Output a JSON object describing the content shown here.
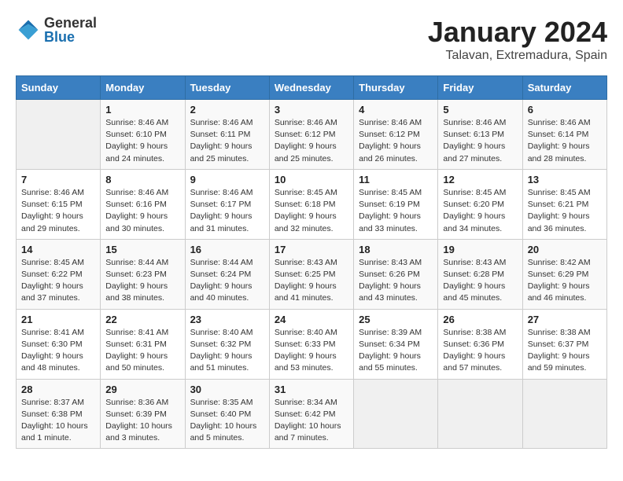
{
  "header": {
    "logo_general": "General",
    "logo_blue": "Blue",
    "month_title": "January 2024",
    "location": "Talavan, Extremadura, Spain"
  },
  "days_of_week": [
    "Sunday",
    "Monday",
    "Tuesday",
    "Wednesday",
    "Thursday",
    "Friday",
    "Saturday"
  ],
  "weeks": [
    [
      {
        "day": "",
        "info": ""
      },
      {
        "day": "1",
        "info": "Sunrise: 8:46 AM\nSunset: 6:10 PM\nDaylight: 9 hours\nand 24 minutes."
      },
      {
        "day": "2",
        "info": "Sunrise: 8:46 AM\nSunset: 6:11 PM\nDaylight: 9 hours\nand 25 minutes."
      },
      {
        "day": "3",
        "info": "Sunrise: 8:46 AM\nSunset: 6:12 PM\nDaylight: 9 hours\nand 25 minutes."
      },
      {
        "day": "4",
        "info": "Sunrise: 8:46 AM\nSunset: 6:12 PM\nDaylight: 9 hours\nand 26 minutes."
      },
      {
        "day": "5",
        "info": "Sunrise: 8:46 AM\nSunset: 6:13 PM\nDaylight: 9 hours\nand 27 minutes."
      },
      {
        "day": "6",
        "info": "Sunrise: 8:46 AM\nSunset: 6:14 PM\nDaylight: 9 hours\nand 28 minutes."
      }
    ],
    [
      {
        "day": "7",
        "info": "Sunrise: 8:46 AM\nSunset: 6:15 PM\nDaylight: 9 hours\nand 29 minutes."
      },
      {
        "day": "8",
        "info": "Sunrise: 8:46 AM\nSunset: 6:16 PM\nDaylight: 9 hours\nand 30 minutes."
      },
      {
        "day": "9",
        "info": "Sunrise: 8:46 AM\nSunset: 6:17 PM\nDaylight: 9 hours\nand 31 minutes."
      },
      {
        "day": "10",
        "info": "Sunrise: 8:45 AM\nSunset: 6:18 PM\nDaylight: 9 hours\nand 32 minutes."
      },
      {
        "day": "11",
        "info": "Sunrise: 8:45 AM\nSunset: 6:19 PM\nDaylight: 9 hours\nand 33 minutes."
      },
      {
        "day": "12",
        "info": "Sunrise: 8:45 AM\nSunset: 6:20 PM\nDaylight: 9 hours\nand 34 minutes."
      },
      {
        "day": "13",
        "info": "Sunrise: 8:45 AM\nSunset: 6:21 PM\nDaylight: 9 hours\nand 36 minutes."
      }
    ],
    [
      {
        "day": "14",
        "info": "Sunrise: 8:45 AM\nSunset: 6:22 PM\nDaylight: 9 hours\nand 37 minutes."
      },
      {
        "day": "15",
        "info": "Sunrise: 8:44 AM\nSunset: 6:23 PM\nDaylight: 9 hours\nand 38 minutes."
      },
      {
        "day": "16",
        "info": "Sunrise: 8:44 AM\nSunset: 6:24 PM\nDaylight: 9 hours\nand 40 minutes."
      },
      {
        "day": "17",
        "info": "Sunrise: 8:43 AM\nSunset: 6:25 PM\nDaylight: 9 hours\nand 41 minutes."
      },
      {
        "day": "18",
        "info": "Sunrise: 8:43 AM\nSunset: 6:26 PM\nDaylight: 9 hours\nand 43 minutes."
      },
      {
        "day": "19",
        "info": "Sunrise: 8:43 AM\nSunset: 6:28 PM\nDaylight: 9 hours\nand 45 minutes."
      },
      {
        "day": "20",
        "info": "Sunrise: 8:42 AM\nSunset: 6:29 PM\nDaylight: 9 hours\nand 46 minutes."
      }
    ],
    [
      {
        "day": "21",
        "info": "Sunrise: 8:41 AM\nSunset: 6:30 PM\nDaylight: 9 hours\nand 48 minutes."
      },
      {
        "day": "22",
        "info": "Sunrise: 8:41 AM\nSunset: 6:31 PM\nDaylight: 9 hours\nand 50 minutes."
      },
      {
        "day": "23",
        "info": "Sunrise: 8:40 AM\nSunset: 6:32 PM\nDaylight: 9 hours\nand 51 minutes."
      },
      {
        "day": "24",
        "info": "Sunrise: 8:40 AM\nSunset: 6:33 PM\nDaylight: 9 hours\nand 53 minutes."
      },
      {
        "day": "25",
        "info": "Sunrise: 8:39 AM\nSunset: 6:34 PM\nDaylight: 9 hours\nand 55 minutes."
      },
      {
        "day": "26",
        "info": "Sunrise: 8:38 AM\nSunset: 6:36 PM\nDaylight: 9 hours\nand 57 minutes."
      },
      {
        "day": "27",
        "info": "Sunrise: 8:38 AM\nSunset: 6:37 PM\nDaylight: 9 hours\nand 59 minutes."
      }
    ],
    [
      {
        "day": "28",
        "info": "Sunrise: 8:37 AM\nSunset: 6:38 PM\nDaylight: 10 hours\nand 1 minute."
      },
      {
        "day": "29",
        "info": "Sunrise: 8:36 AM\nSunset: 6:39 PM\nDaylight: 10 hours\nand 3 minutes."
      },
      {
        "day": "30",
        "info": "Sunrise: 8:35 AM\nSunset: 6:40 PM\nDaylight: 10 hours\nand 5 minutes."
      },
      {
        "day": "31",
        "info": "Sunrise: 8:34 AM\nSunset: 6:42 PM\nDaylight: 10 hours\nand 7 minutes."
      },
      {
        "day": "",
        "info": ""
      },
      {
        "day": "",
        "info": ""
      },
      {
        "day": "",
        "info": ""
      }
    ]
  ]
}
